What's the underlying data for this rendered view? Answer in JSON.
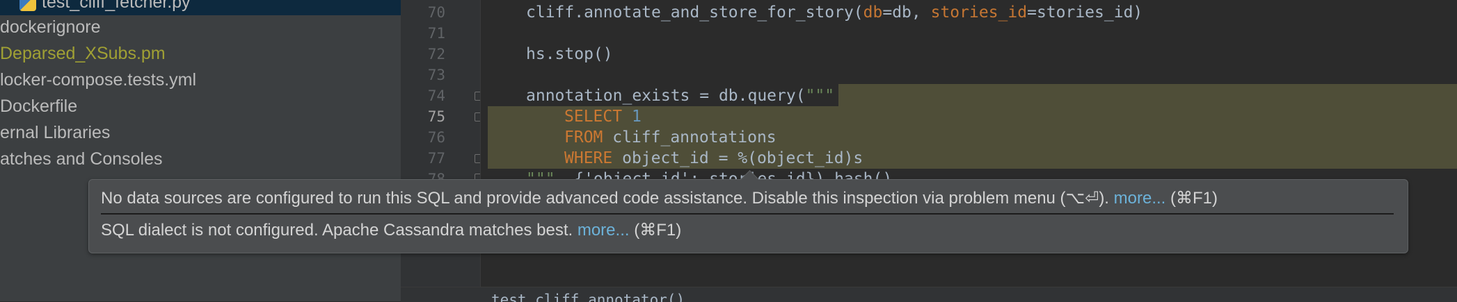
{
  "sidebar": {
    "items": [
      {
        "label": "test_cliff_fetcher.py",
        "icon": "python-file-icon"
      },
      {
        "label": "dockerignore"
      },
      {
        "label": "Deparsed_XSubs.pm"
      },
      {
        "label": "locker-compose.tests.yml"
      },
      {
        "label": "Dockerfile"
      },
      {
        "label": "ernal Libraries"
      },
      {
        "label": "atches and Consoles"
      }
    ]
  },
  "gutter": {
    "lines": [
      "70",
      "71",
      "72",
      "73",
      "74",
      "75",
      "76",
      "77",
      "78"
    ]
  },
  "code": {
    "l70": {
      "a": "cliff.annotate_and_store_for_story(",
      "p1": "db",
      "b": "=db, ",
      "p2": "stories_id",
      "c": "=stories_id)"
    },
    "l72": "hs.stop()",
    "l74": {
      "a": "annotation_exists = db.query(",
      "s": "\"\"\""
    },
    "l75": {
      "kw": "SELECT",
      "num": "1"
    },
    "l76": {
      "kw": "FROM",
      "rest": " cliff_annotations"
    },
    "l77": {
      "kw": "WHERE",
      "rest": " object_id = %(object_id)s"
    },
    "l78": {
      "s": "\"\"\"",
      "rest": ", {'object_id': stories_id}).hash()"
    }
  },
  "bottom_bar": {
    "text": "test_cliff_annotator()"
  },
  "tooltip": {
    "line1": "No data sources are configured to run this SQL and provide advanced code assistance. Disable this inspection via problem menu (⌥⏎).",
    "line1_link": "more...",
    "line1_shortcut": "(⌘F1)",
    "line2": "SQL dialect is not configured. Apache Cassandra matches best.",
    "line2_link": "more...",
    "line2_shortcut": "(⌘F1)"
  },
  "colors": {
    "keyword": "#cc7832",
    "number": "#6897bb",
    "string": "#6a8759",
    "param": "#c57633",
    "sql_highlight": "#4f4e38",
    "link": "#6cb2d9"
  }
}
